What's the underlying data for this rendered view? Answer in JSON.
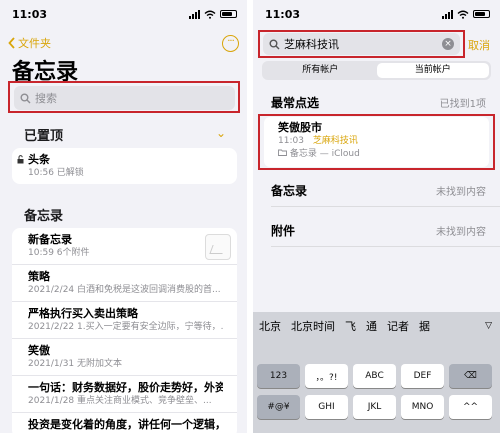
{
  "left": {
    "status": {
      "time": "11:03"
    },
    "nav": {
      "back_label": "文件夹",
      "more_glyph": "···"
    },
    "title": "备忘录",
    "search": {
      "placeholder": "搜索"
    },
    "pinned": {
      "header": "已置顶",
      "items": [
        {
          "title": "头条",
          "subtitle": "10:56  已解锁"
        }
      ]
    },
    "notes": {
      "header": "备忘录",
      "items": [
        {
          "title": "新备忘录",
          "subtitle": "10:59  6个附件"
        },
        {
          "title": "策略",
          "subtitle": "2021/2/24  白酒和免税是这波回调消费股的首..."
        },
        {
          "title": "严格执行买入卖出策略",
          "subtitle": "2021/2/22  1.买入一定要有安全边际，宁等待，..."
        },
        {
          "title": "笑傲",
          "subtitle": "2021/1/31  无附加文本"
        },
        {
          "title": "一句话：财务数据好，股价走势好，外资...",
          "subtitle": "2021/1/28  重点关注商业模式、竞争壁垒、..."
        },
        {
          "title": "投资是变化着的角度，讲任何一个逻辑，..."
        }
      ]
    }
  },
  "right": {
    "status": {
      "time": "11:03"
    },
    "search": {
      "value": "芝麻科技讯",
      "cancel_label": "取消"
    },
    "segment": {
      "options": [
        "所有帐户",
        "当前帐户"
      ],
      "selected": "当前帐户"
    },
    "top_hits": {
      "header": "最常点选",
      "count_label": "已找到1项"
    },
    "result": {
      "title": "笑傲股市",
      "time": "11:03",
      "match": "芝麻科技讯",
      "folder": "备忘录 — iCloud"
    },
    "notes_section": {
      "header": "备忘录",
      "status": "未找到内容"
    },
    "attachments_section": {
      "header": "附件",
      "status": "未找到内容"
    },
    "keyboard": {
      "candidates": [
        "北京",
        "北京时间",
        "飞",
        "通",
        "记者",
        "据"
      ],
      "rows": [
        [
          "123",
          "，。?!",
          "ABC",
          "DEF",
          "⌫"
        ],
        [
          "#@¥",
          "GHI",
          "JKL",
          "MNO",
          "^^"
        ]
      ]
    }
  },
  "colors": {
    "accent": "#d9a50a",
    "annotation": "#c8252c",
    "background": "#f2f2f7"
  }
}
